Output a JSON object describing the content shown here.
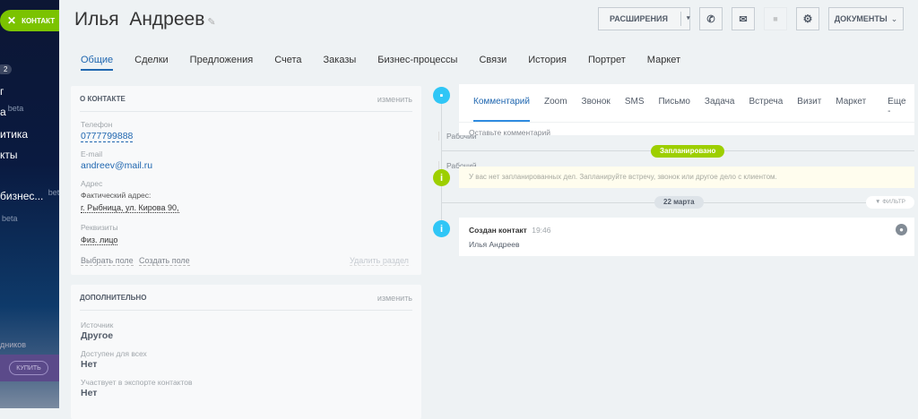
{
  "sidebar": {
    "contact_button": "КОНТАКТ",
    "badge": "2",
    "items": [
      "г",
      "а",
      "итика",
      "кты",
      "бизнес...",
      "",
      "дников"
    ],
    "beta": "beta",
    "buy": "КУПИТЬ"
  },
  "header": {
    "title": "Илья  Андреев",
    "extensions": "РАСШИРЕНИЯ",
    "documents": "ДОКУМЕНТЫ"
  },
  "tabs": [
    "Общие",
    "Сделки",
    "Предложения",
    "Счета",
    "Заказы",
    "Бизнес-процессы",
    "Связи",
    "История",
    "Портрет",
    "Маркет"
  ],
  "about": {
    "title": "О КОНТАКТЕ",
    "edit": "изменить",
    "phone_label": "Телефон",
    "phone": "0777799888",
    "phone_type": "Рабочий",
    "email_label": "E-mail",
    "email": "andreev@mail.ru",
    "email_type": "Рабочий",
    "address_label": "Адрес",
    "address_sub": "Фактический адрес:",
    "address": "г. Рыбница, ул. Кирова 90,",
    "req_label": "Реквизиты",
    "req": "Физ. лицо",
    "select_field": "Выбрать поле",
    "create_field": "Создать поле",
    "delete_section": "Удалить раздел"
  },
  "extra": {
    "title": "ДОПОЛНИТЕЛЬНО",
    "edit": "изменить",
    "fields": [
      {
        "label": "Источник",
        "value": "Другое"
      },
      {
        "label": "Доступен для всех",
        "value": "Нет"
      },
      {
        "label": "Участвует в экспорте контактов",
        "value": "Нет"
      }
    ]
  },
  "timeline": {
    "actions": [
      "Комментарий",
      "Zoom",
      "Звонок",
      "SMS",
      "Письмо",
      "Задача",
      "Встреча",
      "Визит",
      "Маркет",
      "Еще -"
    ],
    "comment_placeholder": "Оставьте комментарий",
    "planned": "Запланировано",
    "no_plans": "У вас нет запланированных дел. Запланируйте встречу, звонок или другое дело с клиентом.",
    "date": "22 марта",
    "filter": "ФИЛЬТР",
    "event_title": "Создан контакт",
    "event_time": "19:46",
    "event_body": "Илья Андреев"
  }
}
